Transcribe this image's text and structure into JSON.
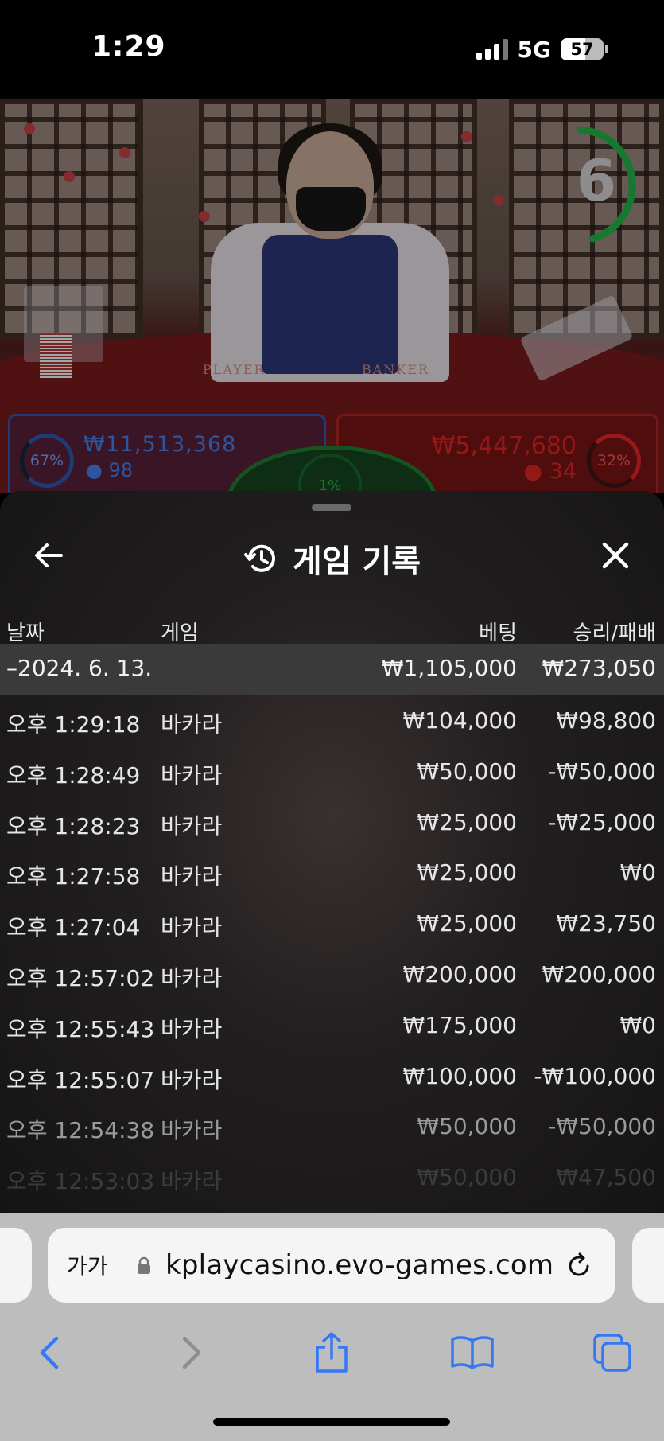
{
  "status_bar": {
    "time": "1:29",
    "network": "5G",
    "battery": "57"
  },
  "video": {
    "timer": "6",
    "table_left_label": "PLAYER",
    "table_right_label": "BANKER",
    "player": {
      "percent": "67%",
      "amount": "₩11,513,368",
      "count": "98"
    },
    "banker": {
      "percent": "32%",
      "amount": "₩5,447,680",
      "count": "34"
    },
    "tie": {
      "percent": "1%"
    }
  },
  "sheet": {
    "title": "게임 기록",
    "columns": {
      "date": "날짜",
      "game": "게임",
      "bet": "베팅",
      "result": "승리/패배"
    },
    "summary": {
      "date": "–2024. 6. 13.",
      "bet": "₩1,105,000",
      "result": "₩273,050"
    },
    "rows": [
      {
        "time": "오후 1:29:18",
        "game": "바카라",
        "bet": "₩104,000",
        "result": "₩98,800"
      },
      {
        "time": "오후 1:28:49",
        "game": "바카라",
        "bet": "₩50,000",
        "result": "-₩50,000"
      },
      {
        "time": "오후 1:28:23",
        "game": "바카라",
        "bet": "₩25,000",
        "result": "-₩25,000"
      },
      {
        "time": "오후 1:27:58",
        "game": "바카라",
        "bet": "₩25,000",
        "result": "₩0"
      },
      {
        "time": "오후 1:27:04",
        "game": "바카라",
        "bet": "₩25,000",
        "result": "₩23,750"
      },
      {
        "time": "오후 12:57:02",
        "game": "바카라",
        "bet": "₩200,000",
        "result": "₩200,000"
      },
      {
        "time": "오후 12:55:43",
        "game": "바카라",
        "bet": "₩175,000",
        "result": "₩0"
      },
      {
        "time": "오후 12:55:07",
        "game": "바카라",
        "bet": "₩100,000",
        "result": "-₩100,000"
      },
      {
        "time": "오후 12:54:38",
        "game": "바카라",
        "bet": "₩50,000",
        "result": "-₩50,000"
      },
      {
        "time": "오후 12:53:03",
        "game": "바카라",
        "bet": "₩50,000",
        "result": "₩47,500"
      }
    ]
  },
  "browser": {
    "text_size": "가가",
    "url": "kplaycasino.evo-games.com"
  },
  "colors": {
    "accent": "#3478f6",
    "player_blue": "#3d73d4",
    "banker_red": "#c62020",
    "tie_green": "#26a33c"
  }
}
